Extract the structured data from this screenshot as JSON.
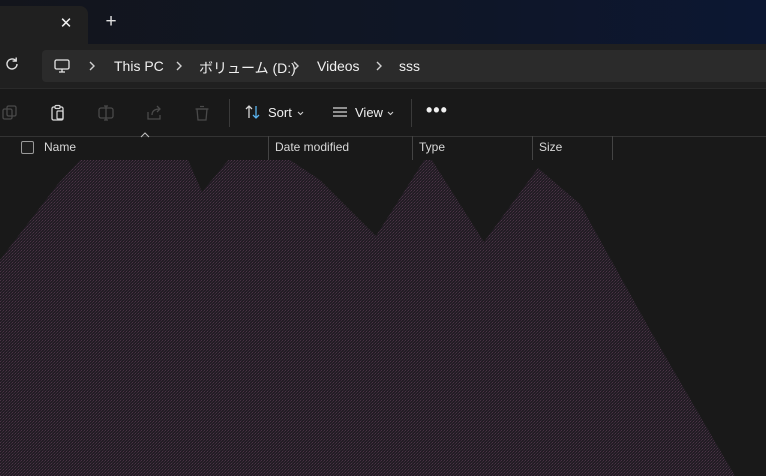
{
  "window": {
    "tab_close_icon": "close-icon",
    "new_tab_icon": "plus-icon"
  },
  "address_bar": {
    "breadcrumbs": [
      {
        "label": "This PC"
      },
      {
        "label": "ボリューム (D:)"
      },
      {
        "label": "Videos"
      },
      {
        "label": "sss"
      }
    ]
  },
  "toolbar": {
    "sort_label": "Sort",
    "view_label": "View",
    "more_label": "•••"
  },
  "columns": [
    {
      "label": "Name"
    },
    {
      "label": "Date modified"
    },
    {
      "label": "Type"
    },
    {
      "label": "Size"
    }
  ],
  "colors": {
    "background": "#191919",
    "toolbar": "#202020",
    "address_bg": "#2b2b2b",
    "accent": "#5ab4f0",
    "pattern": "#2d2230"
  }
}
